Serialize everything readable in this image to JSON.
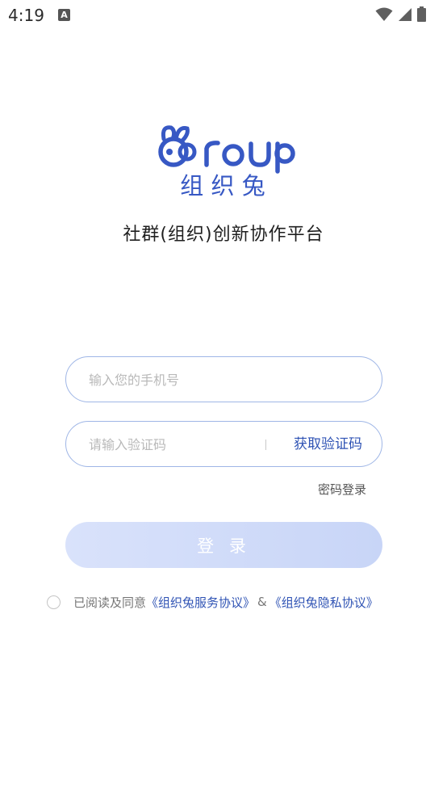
{
  "status_bar": {
    "time": "4:19",
    "notification_letter": "A"
  },
  "brand": {
    "logo_text": "Group",
    "logo_cn": "组 织 兔",
    "slogan": "社群(组织)创新协作平台",
    "primary_color": "#3758c4"
  },
  "login_form": {
    "phone_placeholder": "输入您的手机号",
    "code_placeholder": "请输入验证码",
    "get_code_label": "获取验证码",
    "password_login_label": "密码登录",
    "login_button_label": "登 录"
  },
  "agreement": {
    "prefix": "已阅读及同意",
    "service_link": "《组织兔服务协议》",
    "amp": "&",
    "privacy_link": "《组织兔隐私协议》"
  }
}
